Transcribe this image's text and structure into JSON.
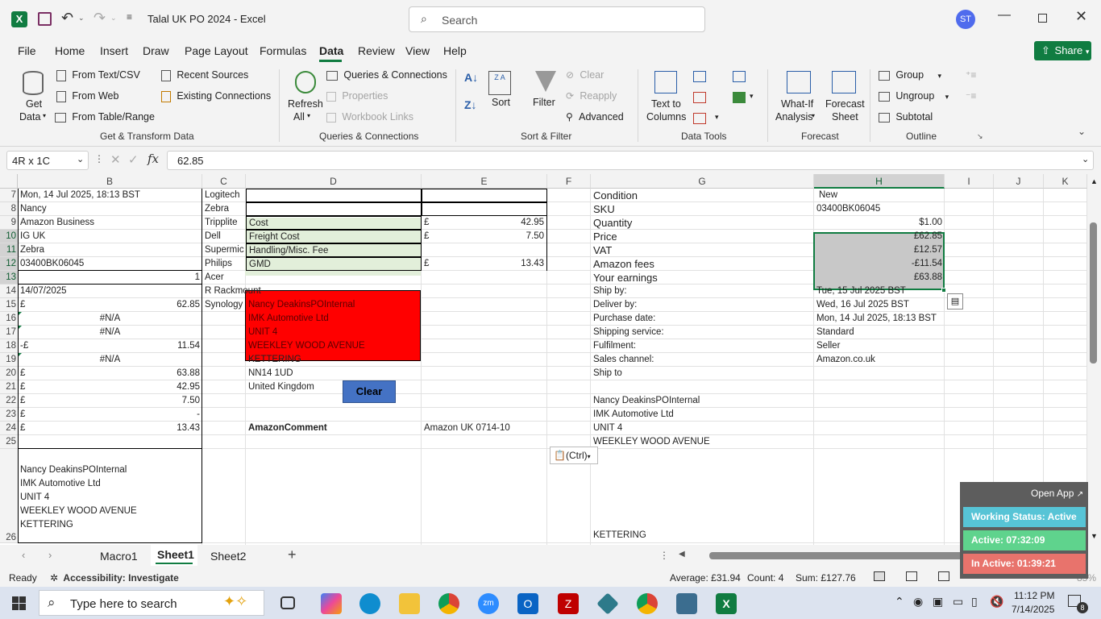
{
  "window": {
    "title": "Talal UK PO 2024  -  Excel",
    "search_placeholder": "Search",
    "user_initials": "ST",
    "share_label": "Share"
  },
  "menu": [
    "File",
    "Home",
    "Insert",
    "Draw",
    "Page Layout",
    "Formulas",
    "Data",
    "Review",
    "View",
    "Help"
  ],
  "ribbon": {
    "get_data": [
      "Get",
      "Data"
    ],
    "from_text": "From Text/CSV",
    "from_web": "From Web",
    "from_table": "From Table/Range",
    "recent_sources": "Recent Sources",
    "existing_connections": "Existing Connections",
    "group_get_transform": "Get & Transform Data",
    "refresh": [
      "Refresh",
      "All"
    ],
    "queries_connections": "Queries & Connections",
    "properties": "Properties",
    "workbook_links": "Workbook Links",
    "group_queries": "Queries & Connections",
    "sort": "Sort",
    "filter": "Filter",
    "clear": "Clear",
    "reapply": "Reapply",
    "advanced": "Advanced",
    "group_sort": "Sort & Filter",
    "text_to_columns": [
      "Text to",
      "Columns"
    ],
    "group_data_tools": "Data Tools",
    "what_if": [
      "What-If",
      "Analysis"
    ],
    "forecast_sheet": [
      "Forecast",
      "Sheet"
    ],
    "group_forecast": "Forecast",
    "group_btn": "Group",
    "ungroup": "Ungroup",
    "subtotal": "Subtotal",
    "group_outline": "Outline"
  },
  "formula_bar": {
    "name_box": "4R x 1C",
    "value": "62.85"
  },
  "columns": [
    "B",
    "C",
    "D",
    "E",
    "F",
    "G",
    "H",
    "I",
    "J",
    "K"
  ],
  "rows": [
    "7",
    "8",
    "9",
    "10",
    "11",
    "12",
    "13",
    "14",
    "15",
    "16",
    "17",
    "18",
    "19",
    "20",
    "21",
    "22",
    "23",
    "24",
    "25",
    "26"
  ],
  "colB": [
    {
      "t": "Mon, 14 Jul 2025, 18:13 BST"
    },
    {
      "t": "Nancy"
    },
    {
      "t": "Amazon Business"
    },
    {
      "t": "IG UK"
    },
    {
      "t": "Zebra"
    },
    {
      "t": "03400BK06045"
    },
    {
      "t": "1"
    },
    {
      "t": "14/07/2025"
    },
    {
      "p": "£",
      "t": "62.85"
    },
    {
      "t": "#N/A"
    },
    {
      "t": "#N/A"
    },
    {
      "p": "-£",
      "t": "11.54"
    },
    {
      "t": "#N/A"
    },
    {
      "p": "£",
      "t": "63.88"
    },
    {
      "p": "£",
      "t": "42.95"
    },
    {
      "p": "£",
      "t": "7.50"
    },
    {
      "p": "£",
      "t": "-"
    },
    {
      "p": "£",
      "t": "13.43"
    }
  ],
  "colC": [
    "Logitech",
    "Zebra",
    "Tripplite",
    "Dell",
    "Supermic",
    "Philips",
    "Acer",
    "R Rackmount",
    "Synology"
  ],
  "colD_costs": [
    "Cost",
    "Freight Cost",
    "Handling/Misc. Fee",
    "GMD"
  ],
  "colE_costs": [
    {
      "p": "£",
      "t": "42.95"
    },
    {
      "p": "£",
      "t": "7.50"
    },
    {
      "p": "",
      "t": ""
    },
    {
      "p": "£",
      "t": "13.43"
    }
  ],
  "colD_address": [
    "Nancy DeakinsPOInternal",
    "IMK Automotive Ltd",
    "UNIT 4",
    "WEEKLEY WOOD AVENUE",
    "KETTERING",
    "NN14 1UD",
    "United Kingdom"
  ],
  "clear_button": "Clear",
  "amazon_comment_label": "AmazonComment",
  "amazon_comment_value": "Amazon UK 0714-10",
  "b26_lines": [
    "Nancy DeakinsPOInternal",
    "IMK Automotive Ltd",
    "UNIT 4",
    "WEEKLEY WOOD AVENUE",
    "KETTERING"
  ],
  "details": [
    {
      "k": "Condition",
      "v": "New"
    },
    {
      "k": "SKU",
      "v": "03400BK06045"
    },
    {
      "k": "Quantity",
      "v": "$1.00"
    },
    {
      "k": "Price",
      "v": "£62.85"
    },
    {
      "k": "VAT",
      "v": "£12.57"
    },
    {
      "k": "Amazon fees",
      "v": "-£11.54"
    },
    {
      "k": "Your earnings",
      "v": "£63.88"
    },
    {
      "k": "Ship by:",
      "v": "Tue, 15 Jul 2025 BST"
    },
    {
      "k": "Deliver by:",
      "v": "Wed, 16 Jul 2025 BST"
    },
    {
      "k": "Purchase date:",
      "v": "Mon, 14 Jul 2025, 18:13 BST"
    },
    {
      "k": "Shipping service:",
      "v": "Standard"
    },
    {
      "k": "Fulfilment:",
      "v": "Seller"
    },
    {
      "k": "Sales channel:",
      "v": "Amazon.co.uk"
    },
    {
      "k": "Ship to",
      "v": ""
    }
  ],
  "g_address": [
    "Nancy DeakinsPOInternal",
    "IMK Automotive Ltd",
    "UNIT 4",
    "WEEKLEY WOOD AVENUE"
  ],
  "g_kettering": "KETTERING",
  "paste_ctrl": "(Ctrl)",
  "overlay": {
    "open_app": "Open App",
    "working": "Working Status: Active",
    "active": "Active: 07:32:09",
    "inactive": "In Active: 01:39:21"
  },
  "sheets": [
    "Macro1",
    "Sheet1",
    "Sheet2"
  ],
  "status": {
    "ready": "Ready",
    "accessibility": "Accessibility: Investigate",
    "average": "Average: £31.94",
    "count": "Count: 4",
    "sum": "Sum: £127.76",
    "zoom": "85%"
  },
  "taskbar": {
    "search": "Type here to search",
    "time": "11:12 PM",
    "date": "7/14/2025",
    "notif": "8"
  },
  "colors": {
    "excel_green": "#107c41",
    "red_fill": "#ff0000",
    "green_fill": "#e2efda",
    "selection_fill": "#c8c8c8",
    "clear_btn": "#4472c4",
    "overlay_green": "#5fd38d",
    "overlay_red": "#e8736c",
    "overlay_blue": "#57c4d6"
  }
}
